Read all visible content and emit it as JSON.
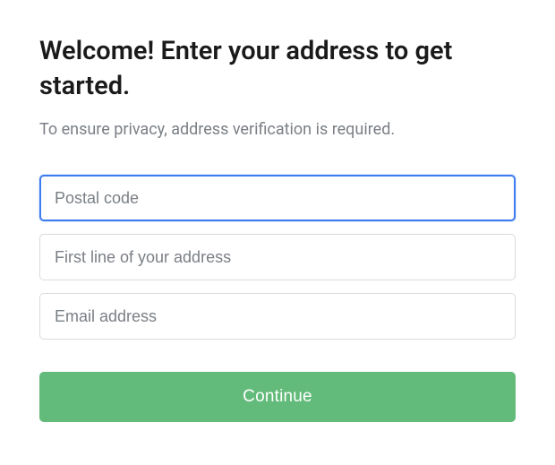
{
  "heading": "Welcome! Enter your address to get started.",
  "subheading": "To ensure privacy, address verification is required.",
  "form": {
    "postal_code": {
      "placeholder": "Postal code",
      "value": ""
    },
    "address_line1": {
      "placeholder": "First line of your address",
      "value": ""
    },
    "email": {
      "placeholder": "Email address",
      "value": ""
    },
    "submit_label": "Continue"
  },
  "colors": {
    "accent": "#62bb7a",
    "focus": "#3d7cf0",
    "text_primary": "#1a1a1a",
    "text_secondary": "#7a7f85",
    "border": "#d7dade"
  }
}
